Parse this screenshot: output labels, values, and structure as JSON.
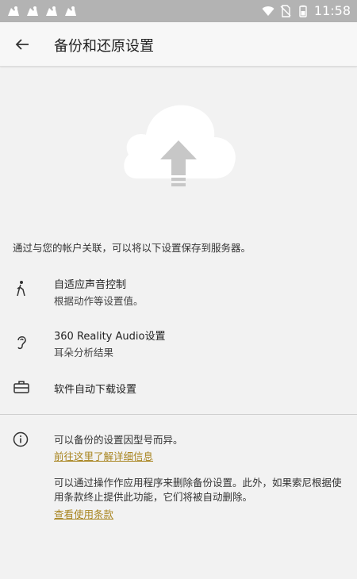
{
  "status_bar": {
    "time": "11:58",
    "notification_icons": [
      "notification-icon-1",
      "notification-icon-2",
      "notification-icon-3",
      "notification-icon-4"
    ],
    "right_icons": [
      "wifi-icon",
      "no-sim-icon",
      "battery-icon"
    ]
  },
  "app_bar": {
    "title": "备份和还原设置",
    "back_icon": "arrow-back-icon"
  },
  "hero": {
    "icon": "cloud-upload-icon"
  },
  "intro_text": "通过与您的帐户关联，可以将以下设置保存到服务器。",
  "settings": [
    {
      "icon": "walking-icon",
      "title": "自适应声音控制",
      "subtitle": "根据动作等设置值。"
    },
    {
      "icon": "ear-icon",
      "title": "360 Reality Audio设置",
      "subtitle": "耳朵分析结果"
    },
    {
      "icon": "toolbox-icon",
      "title": "软件自动下载设置",
      "subtitle": ""
    }
  ],
  "info": {
    "icon": "info-icon",
    "note1": "可以备份的设置因型号而异。",
    "link1": "前往这里了解详细信息",
    "note2": "可以通过操作作应用程序来删除备份设置。此外，如果索尼根据使用条款终止提供此功能，它们将被自动删除。",
    "link2": "查看使用条款"
  },
  "colors": {
    "background": "#f2f2f2",
    "status_bar": "#b3b3b3",
    "link": "#a8841f",
    "cloud": "#ffffff",
    "arrow": "#c7c7c7"
  }
}
